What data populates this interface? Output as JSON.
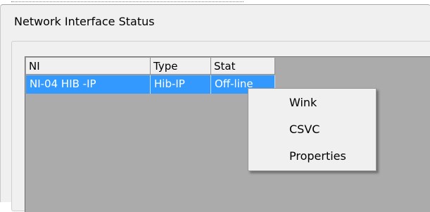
{
  "window": {
    "title": "Network Interface Status"
  },
  "table": {
    "columns": [
      "NI",
      "Type",
      "Stat"
    ],
    "rows": [
      {
        "ni": "NI-04 HIB -IP",
        "type": "Hib-IP",
        "stat": "Off-line"
      }
    ],
    "selected_row_color": "#3399ff"
  },
  "context_menu": {
    "items": [
      "Wink",
      "CSVC",
      "Properties"
    ]
  }
}
